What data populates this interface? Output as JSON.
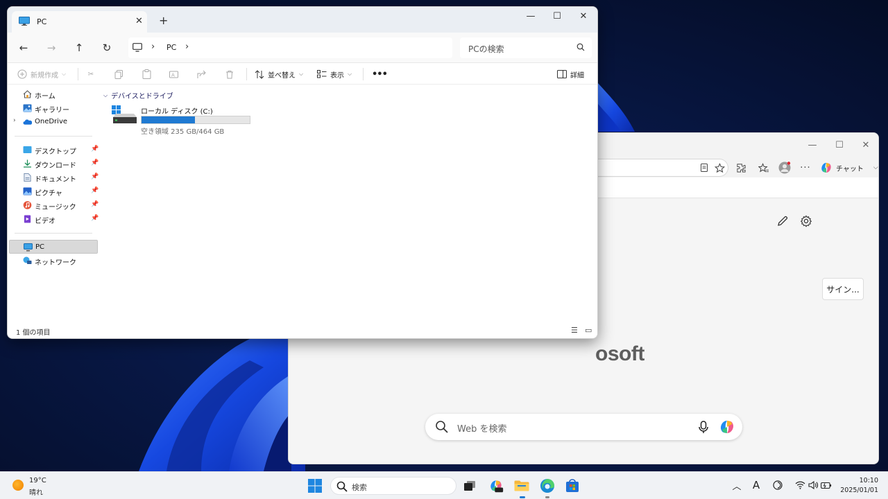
{
  "explorer": {
    "tab_title": "PC",
    "new_tab": "+",
    "window_controls": {
      "minimize": "—",
      "maximize": "☐",
      "close": "✕"
    },
    "address": {
      "root_icon": "monitor-icon",
      "separator": "›",
      "location": "PC",
      "trailing": "›"
    },
    "search_placeholder": "PCの検索",
    "commands": {
      "new": "新規作成",
      "sort": "並べ替え",
      "view": "表示",
      "more": "•••",
      "details": "詳細"
    },
    "nav_pane": {
      "home": "ホーム",
      "gallery": "ギャラリー",
      "onedrive": "OneDrive",
      "desktop": "デスクトップ",
      "downloads": "ダウンロード",
      "documents": "ドキュメント",
      "pictures": "ピクチャ",
      "music": "ミュージック",
      "videos": "ビデオ",
      "pc": "PC",
      "network": "ネットワーク"
    },
    "group_header": "デバイスとドライブ",
    "drive": {
      "name": "ローカル ディスク (C:)",
      "free_text": "空き領域 235 GB/464 GB",
      "used_fraction": 0.4935
    },
    "status": {
      "item_count": "1 個の項目"
    }
  },
  "edge": {
    "window_controls": {
      "minimize": "—",
      "maximize": "☐",
      "close": "✕"
    },
    "chat_label": "チャット",
    "signin_label": "サイン...",
    "logo_text": "osoft",
    "search_placeholder": "Web を検索"
  },
  "taskbar": {
    "weather": {
      "temp": "19°C",
      "condition": "晴れ"
    },
    "search_placeholder": "検索",
    "clock": {
      "time": "10:10",
      "date": "2025/01/01"
    },
    "tray": {
      "ime": "A"
    }
  },
  "colors": {
    "accent": "#1f7ad2",
    "wallpaper_dark": "#061230",
    "wallpaper_bloom": "#1a55f0"
  }
}
